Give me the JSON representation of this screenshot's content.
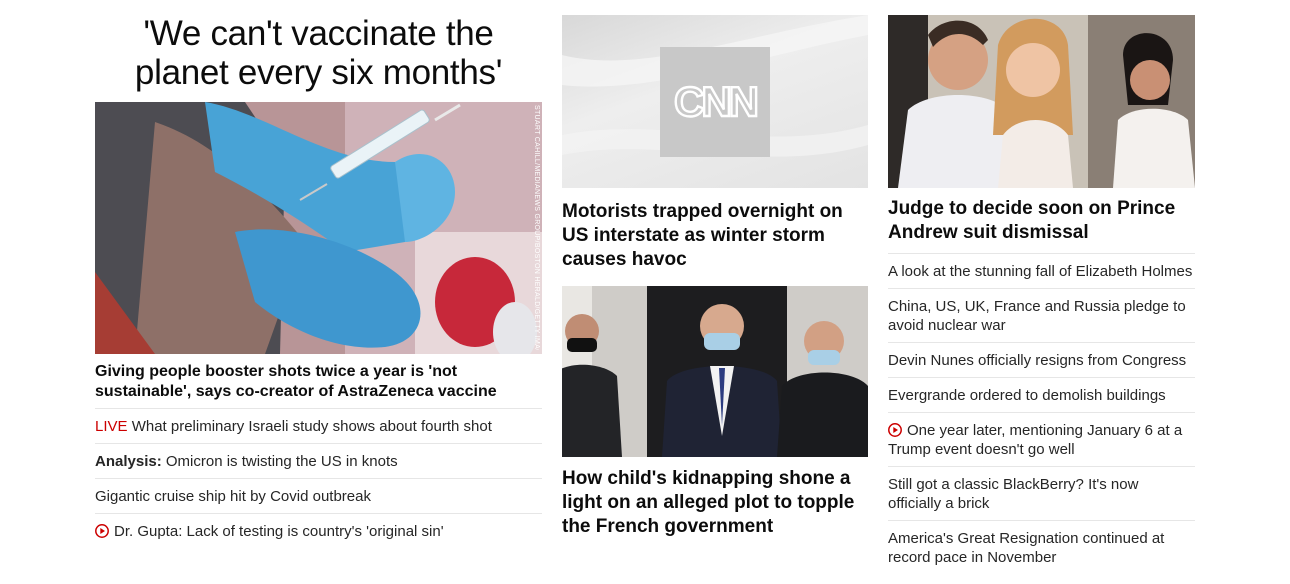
{
  "column1": {
    "headline": "'We can't vaccinate the planet every six months'",
    "image_credit": "Stuart Cahill/MediaNews Group/Boston Herald/Getty Images",
    "caption": "Giving people booster shots twice a year is 'not sustainable', says co-creator of AstraZeneca vaccine",
    "items": [
      {
        "prefix": "LIVE",
        "text": "What preliminary Israeli study shows about fourth shot"
      },
      {
        "prefix": "Analysis:",
        "text": "Omicron is twisting the US in knots"
      },
      {
        "text": "Gigantic cruise ship hit by Covid outbreak"
      },
      {
        "text": "Dr. Gupta: Lack of testing is country's 'original sin'",
        "icon": "play-icon"
      }
    ]
  },
  "column2": {
    "card1": {
      "logo": "CNN",
      "headline": "Motorists trapped overnight on US interstate as winter storm causes havoc"
    },
    "card2": {
      "headline": "How child's kidnapping shone a light on an alleged plot to topple the French government"
    }
  },
  "column3": {
    "card": {
      "headline": "Judge to decide soon on Prince Andrew suit dismissal"
    },
    "items": [
      {
        "text": "A look at the stunning fall of Elizabeth Holmes"
      },
      {
        "text": "China, US, UK, France and Russia pledge to avoid nuclear war"
      },
      {
        "text": "Devin Nunes officially resigns from Congress"
      },
      {
        "text": "Evergrande ordered to demolish buildings"
      },
      {
        "text": "One year later, mentioning January 6 at a Trump event doesn't go well",
        "icon": "play-icon"
      },
      {
        "text": "Still got a classic BlackBerry? It's now officially a brick"
      },
      {
        "text": "America's Great Resignation continued at record pace in November"
      }
    ]
  },
  "colors": {
    "live": "#cc0000",
    "headline": "#0c0c0c",
    "text": "#262626",
    "divider": "#e6e6e6"
  }
}
